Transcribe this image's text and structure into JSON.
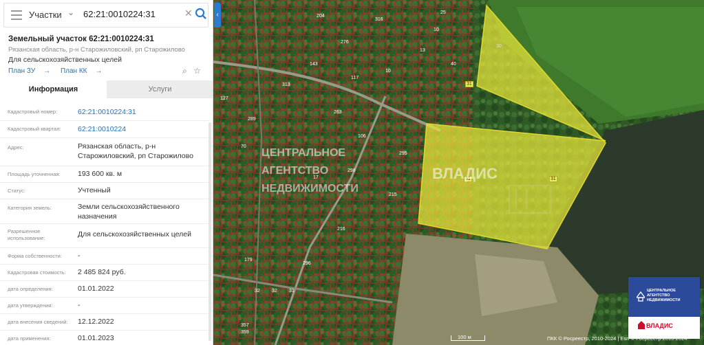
{
  "search": {
    "layer": "Участки",
    "query": "62:21:0010224:31"
  },
  "parcel": {
    "title": "Земельный участок 62:21:0010224:31",
    "address_short": "Рязанская область, р-н Старожиловский, рп Старожилово",
    "purpose": "Для сельскохозяйственных целей",
    "plan_zu": "План ЗУ",
    "plan_kk": "План КК"
  },
  "tabs": [
    "Информация",
    "Услуги"
  ],
  "info_rows": [
    {
      "key": "Кадастровый номер:",
      "value": "62:21:0010224:31",
      "link": true
    },
    {
      "key": "Кадастровый квартал:",
      "value": "62:21:0010224",
      "link": true
    },
    {
      "key": "Адрес:",
      "value": "Рязанская область, р-н Старожиловский, рп Старожилово",
      "link": false
    },
    {
      "key": "Площадь уточненная:",
      "value": "193 600 кв. м",
      "link": false
    },
    {
      "key": "Статус:",
      "value": "Учтенный",
      "link": false
    },
    {
      "key": "Категория земель:",
      "value": "Земли сельскохозяйственного назначения",
      "link": false
    },
    {
      "key": "Разрешенное использование:",
      "value": "Для сельскохозяйственных целей",
      "link": false
    },
    {
      "key": "Форма собственности:",
      "value": "-",
      "link": false
    },
    {
      "key": "Кадастровая стоимость:",
      "value": "2 485 824 руб.",
      "link": false
    },
    {
      "key": "дата определения:",
      "value": "01.01.2022",
      "link": false
    },
    {
      "key": "дата утверждения:",
      "value": "-",
      "link": false
    },
    {
      "key": "дата внесения сведений:",
      "value": "12.12.2022",
      "link": false
    },
    {
      "key": "дата применения:",
      "value": "01.01.2023",
      "link": false
    }
  ],
  "map": {
    "plot_labels": [
      "31",
      "31",
      "31",
      "30"
    ],
    "parcel_numbers": [
      "276",
      "204",
      "70",
      "216",
      "296",
      "289",
      "143",
      "117",
      "127",
      "10",
      "295",
      "215",
      "263",
      "316",
      "313",
      "179",
      "357",
      "359",
      "298",
      "32",
      "32",
      "31",
      "17",
      "10",
      "13",
      "40",
      "106",
      "25"
    ],
    "scale": "100 м",
    "copyright": "ПКК © Росреестр, 2010-2024 | Esri © Росреестр 2010-2024",
    "watermark_line1": "ЦЕНТРАЛЬНОЕ",
    "watermark_line2": "АГЕНТСТВО",
    "watermark_line3": "НЕДВИЖИМОСТИ",
    "watermark_brand": "ВЛАДИС",
    "highlight_color": "#e9e83a"
  },
  "logo": {
    "line1": "ЦЕНТРАЛЬНОЕ",
    "line2": "АГЕНТСТВО",
    "line3": "НЕДВИЖИМОСТИ",
    "brand": "ВЛАДИС",
    "bg_color": "#2c4a9a",
    "brand_color": "#c8102e"
  }
}
